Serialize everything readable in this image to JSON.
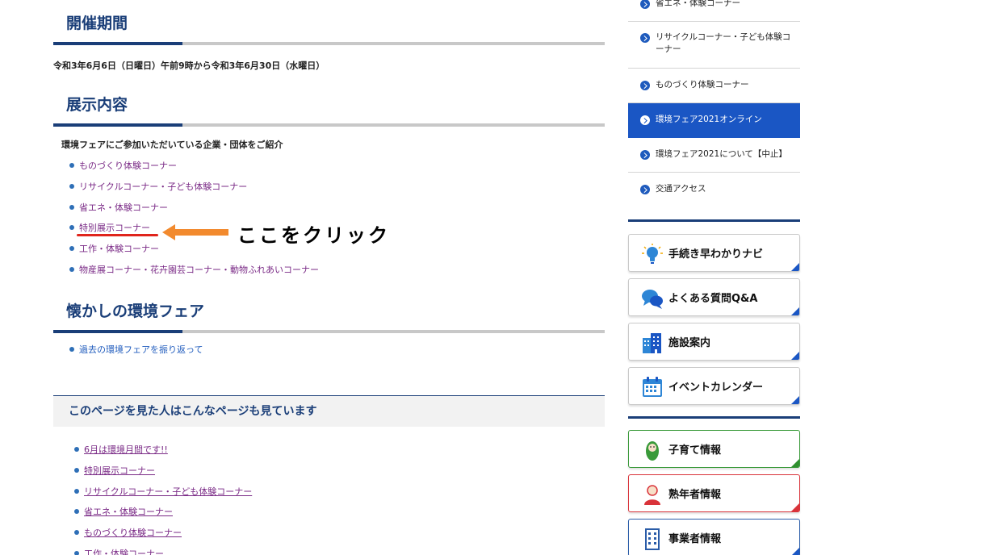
{
  "sections": {
    "period": {
      "title": "開催期間",
      "text": "令和3年6月6日（日曜日）午前9時から令和3年6月30日（水曜日）"
    },
    "exhibit": {
      "title": "展示内容",
      "intro": "環境フェアにご参加いただいている企業・団体をご紹介",
      "links": [
        "ものづくり体験コーナー",
        "リサイクルコーナー・子ども体験コーナー",
        "省エネ・体験コーナー",
        "特別展示コーナー",
        "工作・体験コーナー",
        "物産展コーナー・花卉園芸コーナー・動物ふれあいコーナー"
      ]
    },
    "nostalgic": {
      "title": "懐かしの環境フェア",
      "links": [
        "過去の環境フェアを振り返って"
      ]
    },
    "related": {
      "title": "このページを見た人はこんなページも見ています",
      "links": [
        "6月は環境月間です!!",
        "特別展示コーナー",
        "リサイクルコーナー・子ども体験コーナー",
        "省エネ・体験コーナー",
        "ものづくり体験コーナー",
        "工作・体験コーナー"
      ]
    }
  },
  "annotation": {
    "text": "ここをクリック",
    "color": "#e0241c",
    "arrow_color": "#f28a2e"
  },
  "side_nav": {
    "items": [
      "省エネ・体験コーナー",
      "リサイクルコーナー・子ども体験コーナー",
      "ものづくり体験コーナー",
      "環境フェア2021オンライン",
      "環境フェア2021について【中止】",
      "交通アクセス"
    ],
    "active_index": 3
  },
  "banners": [
    {
      "label": "手続き早わかりナビ",
      "icon": "lightbulb-icon"
    },
    {
      "label": "よくある質問Q&A",
      "icon": "speech-bubbles-icon"
    },
    {
      "label": "施設案内",
      "icon": "building-icon"
    },
    {
      "label": "イベントカレンダー",
      "icon": "calendar-icon"
    }
  ],
  "info_banners": [
    {
      "label": "子育て情報",
      "icon": "baby-icon",
      "color": "#2f8f2f"
    },
    {
      "label": "熟年者情報",
      "icon": "elder-icon",
      "color": "#d9333a"
    },
    {
      "label": "事業者情報",
      "icon": "office-building-icon",
      "color": "#2a5ca8"
    }
  ],
  "colors": {
    "brand_navy": "#1a3e78",
    "link_blue": "#1f5bbd",
    "visited_purple": "#7a2a86",
    "active_bg": "#1a56c4"
  }
}
